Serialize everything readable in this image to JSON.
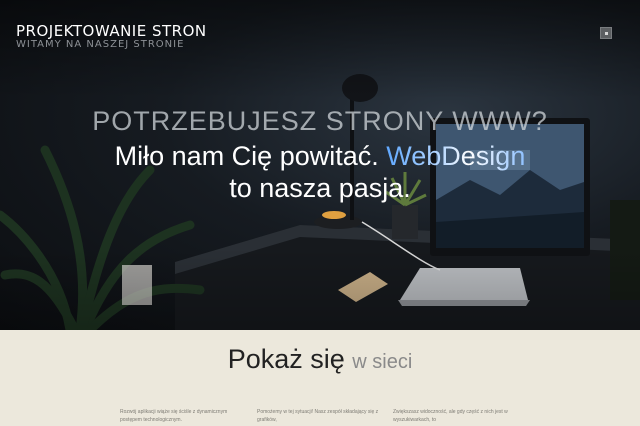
{
  "header": {
    "site_title": "PROJEKTOWANIE STRON",
    "site_subtitle": "WITAMY NA NASZEJ STRONIE",
    "menu_toggle_icon": "menu-toggle-icon"
  },
  "hero": {
    "kicker": "POTRZEBUJESZ STRONY WWW?",
    "headline_part1": "Miło nam Cię powitać.",
    "headline_accent": "WebDesign",
    "headline_line2": "to nasza pasja."
  },
  "section": {
    "title_main": "Pokaż się",
    "title_light": "w sieci",
    "col1": "Rozwój aplikacji wiąże się ściśle z dynamicznym postępem technologicznym.",
    "col2": "Pomożemy w tej sytuacji! Nasz zespół składający się z grafików,",
    "col3": "Zwiększasz widoczność, ale gdy część z nich jest w wyszukiwarkach, to"
  },
  "colors": {
    "accent_gradient_start": "#5fa8ff",
    "content_background": "#ece8dc"
  }
}
